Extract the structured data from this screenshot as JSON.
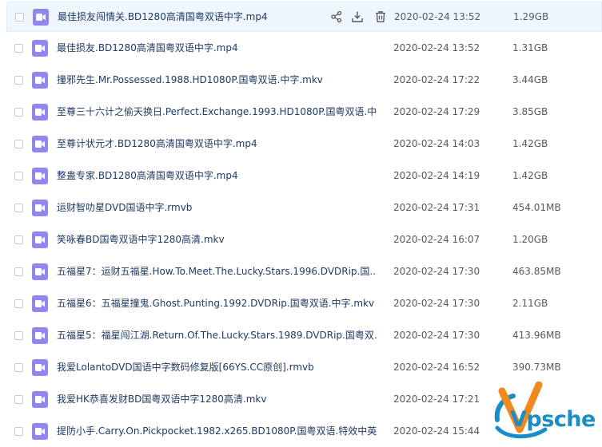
{
  "files": [
    {
      "name": "最佳损友闯情关.BD1280高清国粤双语中字.mp4",
      "date": "2020-02-24 13:52",
      "size": "1.29GB",
      "hovered": true
    },
    {
      "name": "最佳损友.BD1280高清国粤双语中字.mp4",
      "date": "2020-02-24 13:52",
      "size": "1.31GB"
    },
    {
      "name": "撞邪先生.Mr.Possessed.1988.HD1080P.国粤双语.中字.mkv",
      "date": "2020-02-24 17:22",
      "size": "3.44GB"
    },
    {
      "name": "至尊三十六计之偷天换日.Perfect.Exchange.1993.HD1080P.国粤双语.中...",
      "date": "2020-02-24 17:29",
      "size": "3.85GB"
    },
    {
      "name": "至尊计状元才.BD1280高清国粤双语中字.mp4",
      "date": "2020-02-24 14:03",
      "size": "1.42GB"
    },
    {
      "name": "整蛊专家.BD1280高清国粤双语中字.mp4",
      "date": "2020-02-24 14:19",
      "size": "1.42GB"
    },
    {
      "name": "运财智叻星DVD国语中字.rmvb",
      "date": "2020-02-24 17:31",
      "size": "454.01MB"
    },
    {
      "name": "笑咏春BD国粤双语中字1280高清.mkv",
      "date": "2020-02-24 16:07",
      "size": "1.20GB"
    },
    {
      "name": "五福星7：运财五福星.How.To.Meet.The.Lucky.Stars.1996.DVDRip.国...",
      "date": "2020-02-24 17:30",
      "size": "463.85MB"
    },
    {
      "name": "五福星6：五福星撞鬼.Ghost.Punting.1992.DVDRip.国粤双语.中字.mkv",
      "date": "2020-02-24 17:30",
      "size": "2.11GB"
    },
    {
      "name": "五福星5：福星闯江湖.Return.Of.The.Lucky.Stars.1989.DVDRip.国粤双...",
      "date": "2020-02-24 17:30",
      "size": "413.96MB"
    },
    {
      "name": "我爱LolantoDVD国语中字数码修复版[66YS.CC原创].rmvb",
      "date": "2020-02-24 16:52",
      "size": "390.73MB"
    },
    {
      "name": "我爱HK恭喜发财BD国粤双语中字1280高清.mkv",
      "date": "2020-02-24 17:21",
      "size": ""
    },
    {
      "name": "提防小手.Carry.On.Pickpocket.1982.x265.BD1080P.国粤双语.特效中英...",
      "date": "2020-02-24 15:44",
      "size": ""
    }
  ],
  "row_actions": [
    "share-icon",
    "download-icon",
    "delete-icon"
  ],
  "watermark": {
    "text": "Vpsche",
    "colors": {
      "blue": "#1a8cc8",
      "orange": "#f08a1c"
    }
  },
  "colors": {
    "hover_row": "#f0f6fe",
    "video_icon": "#8f87f0",
    "name_text": "#1f3a63",
    "meta_text": "#555a62"
  }
}
